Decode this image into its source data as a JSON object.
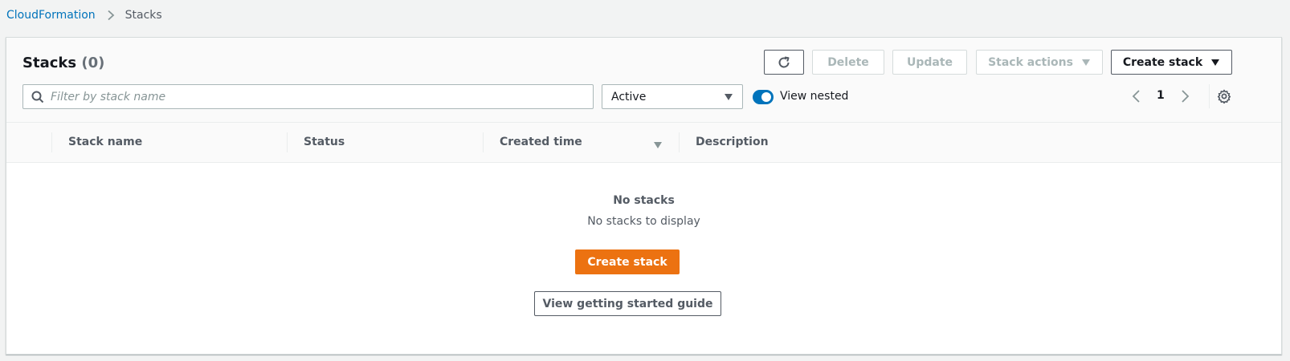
{
  "breadcrumb": {
    "root": "CloudFormation",
    "current": "Stacks"
  },
  "panel": {
    "title": "Stacks",
    "count": "(0)"
  },
  "toolbar": {
    "refresh_icon": "refresh-icon",
    "delete_label": "Delete",
    "update_label": "Update",
    "stack_actions_label": "Stack actions",
    "create_stack_label": "Create stack"
  },
  "filter": {
    "search_placeholder": "Filter by stack name",
    "search_value": "",
    "status_selected": "Active",
    "view_nested_label": "View nested",
    "view_nested_on": true
  },
  "pagination": {
    "current_page": "1"
  },
  "table": {
    "columns": [
      "Stack name",
      "Status",
      "Created time",
      "Description"
    ],
    "sorted_column": "Created time",
    "sort_direction": "descending",
    "rows": []
  },
  "empty_state": {
    "title": "No stacks",
    "message": "No stacks to display",
    "create_label": "Create stack",
    "guide_label": "View getting started guide"
  },
  "colors": {
    "link": "#0073bb",
    "primary_button": "#ec7211",
    "toggle_on": "#0073bb",
    "page_background": "#f2f3f3"
  }
}
